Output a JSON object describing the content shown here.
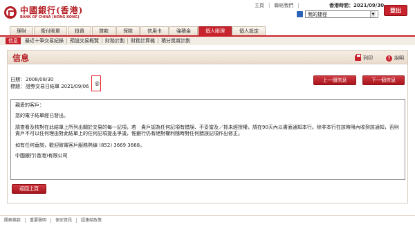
{
  "header": {
    "logo_cn": "中國銀行(香港)",
    "logo_en": "BANK OF CHINA (HONG KONG)",
    "links": [
      "主頁",
      "聯絡我們"
    ],
    "hk_time_label": "香港時間：2021/09/30",
    "logout_label": "登出",
    "favourites_value": "我的捷徑"
  },
  "nav": {
    "tabs": [
      "理財",
      "衛付賬單",
      "投資",
      "貸款",
      "保險",
      "信用卡",
      "強積金",
      "個人賬理",
      "個人設定"
    ],
    "active_index": 7,
    "subtabs": [
      "信息",
      "最近十筆交易紀錄",
      "預設交易概覽",
      "財務計劃",
      "財務計算機",
      "積分獎賞計劃"
    ]
  },
  "content": {
    "title": "信息",
    "print_label": "列印",
    "help_label": "說明",
    "date_label": "日期：",
    "date_value": "2008/08/30",
    "subject_label": "標題：",
    "subject_value": "證券交易日結單 2021/09/06",
    "at_symbol": "@",
    "prev_button": "上一個信息",
    "next_button": "下一個信息",
    "message": {
      "greeting": "親愛的客戶：",
      "line1": "您的電子結單經已發出。",
      "line2": "請查看及核對在此結單上所列出關於交易的每一記項，若　貴戶認為任何記項有錯誤、不妥當及／抓未經授權，請在90天內以書面通知本行。除非本行在該時限內收到該通知，否則　貴戶不可以任何理由對此結單上的任何記項提出爭議，惟銀行仍有絕對權利隨時對任何錯誤記項作出修正。",
      "line3": "如有任何垂詢，歡迎致電客戶服務熱線 (852) 3669 3668。",
      "signature": "中國銀行(香港)有限公司"
    },
    "back_button": "返回上頁"
  },
  "footer": {
    "links": [
      "關務條款",
      "重要聲明",
      "保安資訊",
      "超連結政策"
    ]
  },
  "colors": {
    "brand_red": "#c8232c",
    "tab_beige": "#e9ddcf"
  }
}
